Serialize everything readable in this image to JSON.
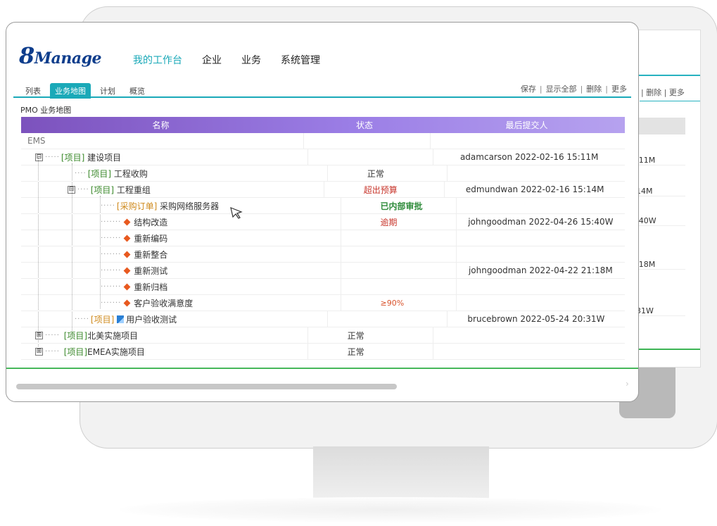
{
  "app": {
    "logo_num": "8",
    "logo_text": "Manage"
  },
  "topnav": [
    {
      "label": "我的工作台"
    },
    {
      "label": "企业"
    },
    {
      "label": "业务"
    },
    {
      "label": "系统管理"
    }
  ],
  "tabs": [
    {
      "label": "列表"
    },
    {
      "label": "业务地图"
    },
    {
      "label": "计划"
    },
    {
      "label": "概览"
    }
  ],
  "actions": {
    "save": "保存",
    "show_all": "显示全部",
    "delete": "删除",
    "more": "更多",
    "sep": "|"
  },
  "section_title": "PMO 业务地图",
  "grid": {
    "headers": {
      "name": "名称",
      "status": "状态",
      "user": "最后提交人"
    },
    "rows": [
      {
        "name": "EMS",
        "status": "",
        "user": ""
      },
      {
        "tag": "[项目]",
        "name": "建设项目",
        "status": "",
        "user": "adamcarson 2022-02-16 15:11M"
      },
      {
        "tag": "[项目]",
        "name": "工程收购",
        "status": "正常",
        "user": ""
      },
      {
        "tag": "[项目]",
        "name": "工程重组",
        "status": "超出预算",
        "user": "edmundwan 2022-02-16 15:14M"
      },
      {
        "tag": "[采购订单]",
        "name": "采购网络服务器",
        "status": "已内部审批",
        "user": ""
      },
      {
        "name": "结构改造",
        "status": "逾期",
        "user": "johngoodman 2022-04-26 15:40W"
      },
      {
        "name": "重新编码",
        "status": "",
        "user": ""
      },
      {
        "name": "重新整合",
        "status": "",
        "user": ""
      },
      {
        "name": "重新测试",
        "status": "",
        "user": "johngoodman 2022-04-22 21:18M"
      },
      {
        "name": "重新归档",
        "status": "",
        "user": ""
      },
      {
        "name": "客户验收满意度",
        "status": "≥90%",
        "user": ""
      },
      {
        "tag": "[项目]",
        "name": "用户验收测试",
        "status": "",
        "user": "brucebrown 2022-05-24 20:31W"
      },
      {
        "tag": "[项目]",
        "name": "北美实施项目",
        "status": "正常",
        "user": ""
      },
      {
        "tag": "[项目]",
        "name": "EMEA实施项目",
        "status": "正常",
        "user": ""
      }
    ]
  },
  "back_window": {
    "actions": "| 删除 | 更多",
    "cells": [
      ":11M",
      "14M",
      ":40W",
      ":18M",
      "31W"
    ]
  },
  "icons": {
    "expand_minus": "⊟",
    "expand_plus": "⊞",
    "diamond": "diamond-icon",
    "doc": "doc-icon",
    "cursor": "cursor-icon",
    "scroll_right": "›"
  },
  "colors": {
    "accent": "#1aa9b8",
    "brand": "#0e3d8c",
    "header_grad_start": "#7c52bd",
    "header_grad_end": "#b6a2ef",
    "diamond": "#e8591f"
  }
}
